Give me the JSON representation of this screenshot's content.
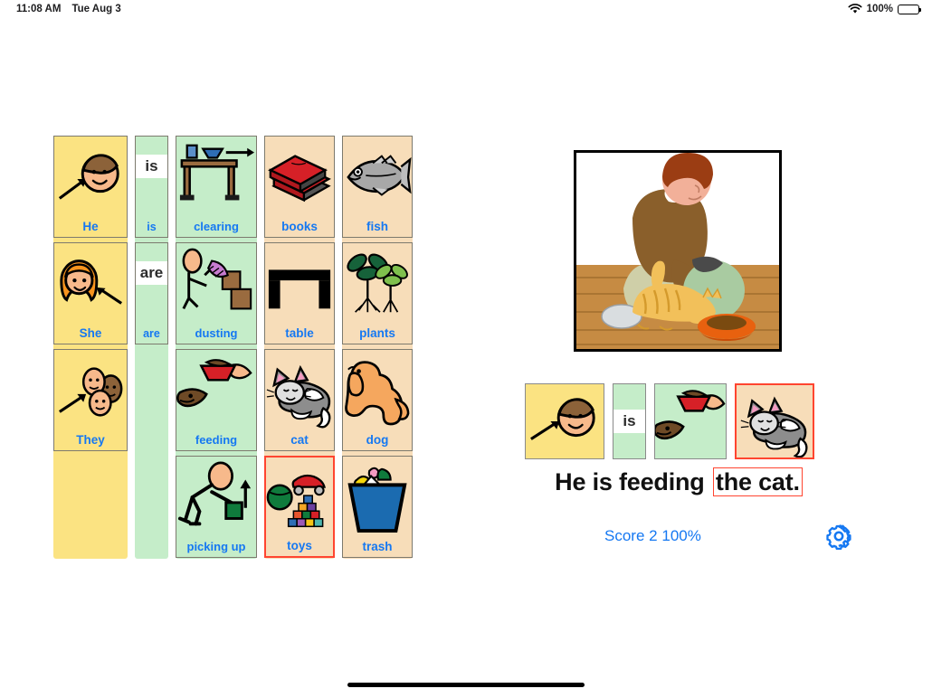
{
  "status_bar": {
    "time": "11:08 AM",
    "date": "Tue Aug 3",
    "wifi_icon": "wifi-icon",
    "battery_percent": "100%",
    "battery_icon": "battery-full-icon"
  },
  "theme": {
    "subject_bg": "#FBE382",
    "verb_bg": "#C5EDC9",
    "object_bg": "#F7DDB9",
    "label_blue": "#1578F2",
    "selection_red": "#FF4530",
    "card_border": "#7d7a6e"
  },
  "word_board": {
    "columns": [
      {
        "name": "subject-column",
        "kind": "yellow",
        "cards": [
          {
            "label": "He",
            "art": "boy-face-arrow-icon",
            "selected": false
          },
          {
            "label": "She",
            "art": "girl-face-arrow-icon",
            "selected": false
          },
          {
            "label": "They",
            "art": "three-faces-arrow-icon",
            "selected": false
          }
        ],
        "empty_slots": 1
      },
      {
        "name": "verb-to-be-column",
        "kind": "narrow-green",
        "cards": [
          {
            "label": "is",
            "word_chip": "is",
            "art": "word-card-icon",
            "selected": false
          },
          {
            "label": "are",
            "word_chip": "are",
            "art": "word-card-icon",
            "selected": false
          }
        ],
        "empty_slots": 0
      },
      {
        "name": "action-verb-column",
        "kind": "green",
        "cards": [
          {
            "label": "clearing",
            "art": "table-clearing-icon",
            "selected": false
          },
          {
            "label": "dusting",
            "art": "dusting-person-icon",
            "selected": false
          },
          {
            "label": "feeding",
            "art": "feeding-dog-bowl-icon",
            "selected": false
          },
          {
            "label": "picking up",
            "art": "picking-up-person-icon",
            "selected": false
          }
        ],
        "empty_slots": 0
      },
      {
        "name": "object-column-1",
        "kind": "peach",
        "cards": [
          {
            "label": "books",
            "art": "red-books-icon",
            "selected": false
          },
          {
            "label": "table",
            "art": "black-table-icon",
            "selected": false
          },
          {
            "label": "cat",
            "art": "grey-cat-icon",
            "selected": false
          },
          {
            "label": "toys",
            "art": "toys-icon",
            "selected": true
          }
        ],
        "empty_slots": 0
      },
      {
        "name": "object-column-2",
        "kind": "peach",
        "cards": [
          {
            "label": "fish",
            "art": "fish-icon",
            "selected": false
          },
          {
            "label": "plants",
            "art": "plants-icon",
            "selected": false
          },
          {
            "label": "dog",
            "art": "orange-dog-icon",
            "selected": false
          },
          {
            "label": "trash",
            "art": "trash-bin-icon",
            "selected": false
          }
        ],
        "empty_slots": 0
      }
    ]
  },
  "scene": {
    "name": "boy-feeding-cat-photo",
    "description": "Boy kneeling on wooden floor feeding an orange cat from an orange bowl"
  },
  "answer_strip": {
    "cards": [
      {
        "name": "answer-subject",
        "kind": "yellow",
        "art": "boy-face-arrow-icon",
        "selected": false
      },
      {
        "name": "answer-be-verb",
        "kind": "narrow",
        "art": "word-card-icon",
        "word_chip": "is",
        "selected": false
      },
      {
        "name": "answer-action",
        "kind": "green",
        "art": "feeding-dog-bowl-icon",
        "selected": false
      },
      {
        "name": "answer-object",
        "kind": "peach",
        "art": "grey-cat-icon",
        "selected": true
      }
    ]
  },
  "sentence": {
    "prefix": "He is feeding ",
    "highlight": "the cat."
  },
  "score": {
    "label": "Score",
    "value": "2",
    "percent": "100%"
  },
  "settings": {
    "gear_icon": "gear-icon"
  },
  "home_indicator": "home-indicator"
}
